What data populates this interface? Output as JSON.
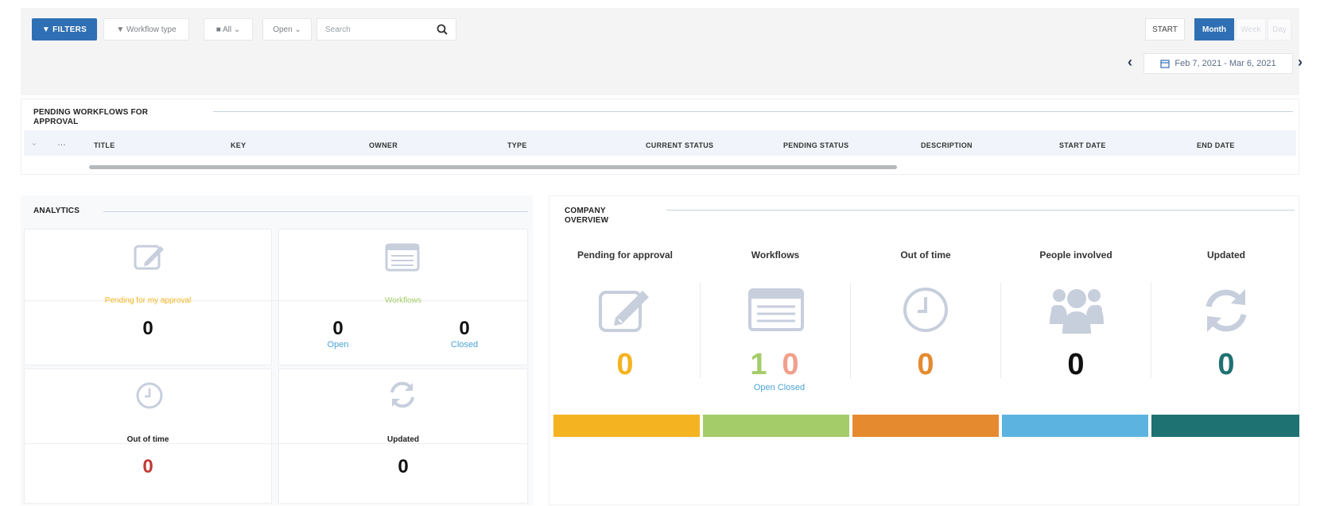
{
  "toolbar": {
    "filters_label": "▼ FILTERS",
    "workflow_type_label": "▼ Workflow type",
    "all_label": "■ All ⌄",
    "open_label": "Open ⌄",
    "search_placeholder": "Search",
    "start_label": "START",
    "views": [
      "Month",
      "Week",
      "Day"
    ],
    "date_range": "Feb 7, 2021 - Mar 6, 2021"
  },
  "pending": {
    "title_line1": "PENDING WORKFLOWS FOR",
    "title_line2": "APPROVAL",
    "ellipsis": "…",
    "columns": [
      "TITLE",
      "KEY",
      "OWNER",
      "TYPE",
      "CURRENT STATUS",
      "PENDING STATUS",
      "DESCRIPTION",
      "START DATE",
      "END DATE"
    ]
  },
  "analytics": {
    "title": "ANALYTICS",
    "pending_label": "Pending for my approval",
    "pending_value": "0",
    "workflows_label": "Workflows",
    "open_value": "0",
    "open_label": "Open",
    "closed_value": "0",
    "closed_label": "Closed",
    "out_of_time_label": "Out of time",
    "out_of_time_value": "0",
    "updated_label": "Updated",
    "updated_value": "0"
  },
  "company": {
    "title_line1": "COMPANY",
    "title_line2": "OVERVIEW",
    "pending_label": "Pending for approval",
    "pending_value": "0",
    "workflows_label": "Workflows",
    "open_value": "1",
    "closed_value": "0",
    "open_label": "Open",
    "closed_label": "Closed",
    "out_of_time_label": "Out of time",
    "out_of_time_value": "0",
    "people_label": "People involved",
    "people_value": "0",
    "updated_label": "Updated",
    "updated_value": "0"
  },
  "colors": {
    "primary": "#2f6fb3",
    "yellow": "#f4b321",
    "green": "#a4cc68",
    "orange": "#e58a2f",
    "blue": "#5cb3e0",
    "teal": "#1f7272",
    "red": "#c23934",
    "salmon": "#f0a08c",
    "icon_gray": "#c7cedc"
  }
}
